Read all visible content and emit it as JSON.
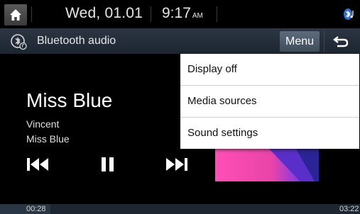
{
  "status": {
    "date": "Wed, 01.01",
    "time": "9:17",
    "ampm": "AM"
  },
  "header": {
    "title": "Bluetooth audio",
    "menu_label": "Menu"
  },
  "now_playing": {
    "title": "Miss Blue",
    "artist": "Vincent",
    "album": "Miss Blue"
  },
  "progress": {
    "elapsed": "00:28",
    "total": "03:22",
    "fraction": 0.14
  },
  "menu": {
    "items": [
      {
        "label": "Display off"
      },
      {
        "label": "Media sources"
      },
      {
        "label": "Sound settings"
      }
    ]
  },
  "colors": {
    "background": "#000000",
    "title_bar": "#252e3a",
    "menu_button": "#4f5c6b",
    "dropdown": "#ffffff"
  },
  "icons": {
    "home": "home-icon",
    "bluetooth_status": "bluetooth-icon",
    "bluetooth_audio": "bluetooth-audio-icon",
    "back": "back-arrow-icon",
    "prev": "previous-track-icon",
    "pause": "pause-icon",
    "next": "next-track-icon"
  }
}
